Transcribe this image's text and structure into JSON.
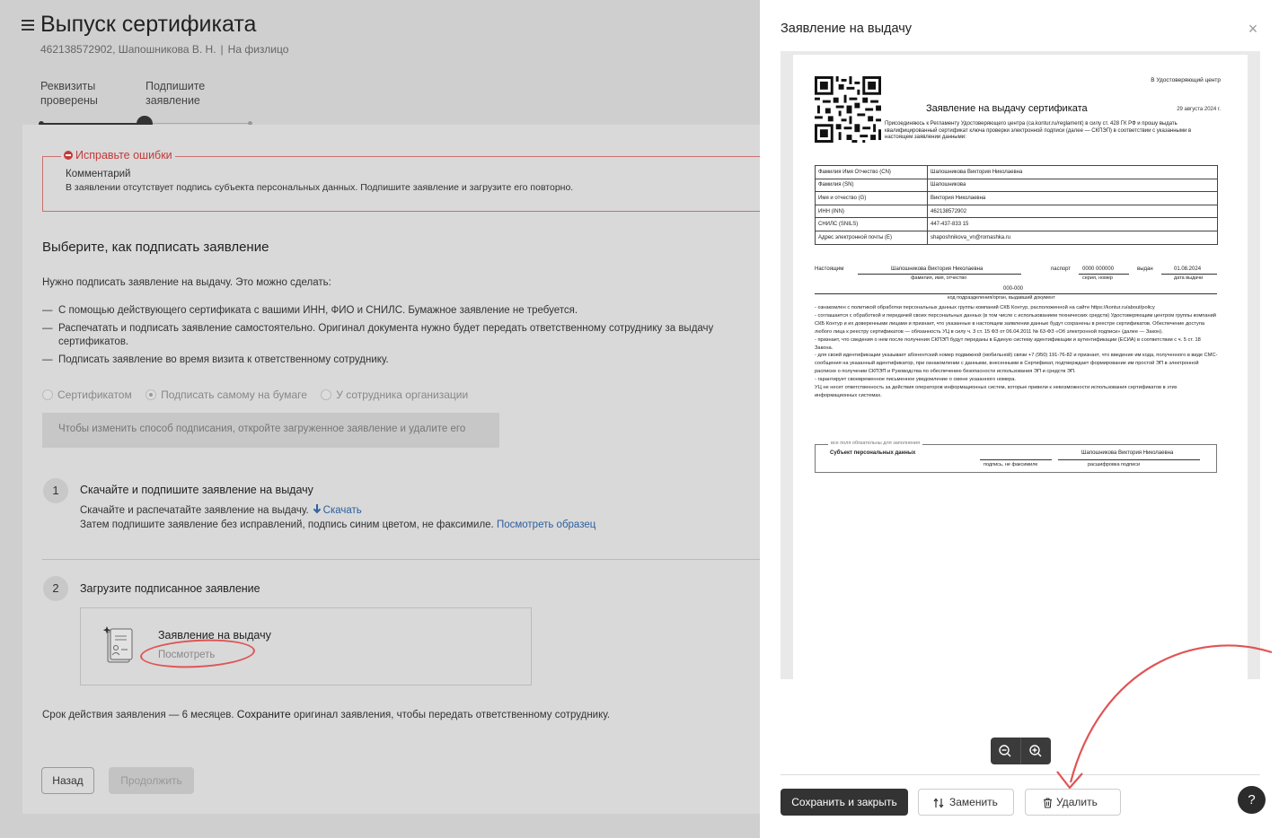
{
  "page": {
    "title": "Выпуск сертификата",
    "subtitle_id": "462138572902, Шапошникова В. Н.",
    "subtitle_sep": "|",
    "subtitle_type": "На физлицо"
  },
  "stepper": {
    "steps": [
      {
        "label": "Реквизиты проверены",
        "state": "done"
      },
      {
        "label": "Подпишите заявление",
        "state": "current"
      }
    ]
  },
  "error": {
    "title": "Исправьте ошибки",
    "comment_label": "Комментарий",
    "comment_text": "В заявлении отсутствует подпись субъекта персональных данных. Подпишите заявление и загрузите его повторно."
  },
  "sign": {
    "heading": "Выберите, как подписать заявление",
    "intro": "Нужно подписать заявление на выдачу. Это можно сделать:",
    "bullets": [
      "С помощью действующего сертификата с вашими ИНН, ФИО и СНИЛС. Бумажное заявление не требуется.",
      "Распечатать и подписать заявление самостоятельно. Оригинал документа нужно будет передать ответственному сотруднику за выдачу сертификатов.",
      "Подписать заявление во время визита к ответственному сотруднику."
    ],
    "options": [
      {
        "label": "Сертификатом",
        "checked": false
      },
      {
        "label": "Подписать самому на бумаге",
        "checked": true
      },
      {
        "label": "У сотрудника организации",
        "checked": false
      }
    ],
    "hint": "Чтобы изменить способ подписания, откройте загруженное заявление и удалите его"
  },
  "step1": {
    "num": "1",
    "title": "Скачайте и подпишите заявление на выдачу",
    "text1": "Скачайте и распечатайте заявление на выдачу.",
    "download": "Скачать",
    "text2": "Затем подпишите заявление без исправлений, подпись синим цветом, не факсимиле.",
    "sample": "Посмотреть образец"
  },
  "step2": {
    "num": "2",
    "title": "Загрузите подписанное заявление",
    "file_name": "Заявление на выдачу",
    "file_view": "Посмотреть"
  },
  "validity": {
    "text1": "Срок действия заявления — 6 месяцев.",
    "bold": "Сохраните",
    "text2": "оригинал заявления, чтобы передать ответственному сотруднику."
  },
  "buttons": {
    "back": "Назад",
    "next": "Продолжить"
  },
  "panel": {
    "title": "Заявление на выдачу",
    "close": "×",
    "save": "Сохранить и закрыть",
    "replace": "Заменить",
    "delete": "Удалить",
    "help": "?"
  },
  "doc": {
    "to": "В Удостоверяющий центр",
    "title": "Заявление на выдачу сертификата",
    "date": "29 августа 2024 г.",
    "intro": "Присоединяюсь к Регламенту Удостоверяющего центра (ca.kontur.ru/reglament) в силу ст. 428 ГК РФ и прошу выдать квалифицированный сертификат ключа проверки электронной подписи (далее — СКПЭП) в соответствии с указанными в настоящем заявлении данными:",
    "rows": [
      {
        "k": "Фамилия Имя Отчество (CN)",
        "v": "Шапошникова Виктория Николаевна"
      },
      {
        "k": "Фамилия (SN)",
        "v": "Шапошникова"
      },
      {
        "k": "Имя и отчество (G)",
        "v": "Виктория Николаевна"
      },
      {
        "k": "ИНН (INN)",
        "v": "462138572902"
      },
      {
        "k": "СНИЛС (SNILS)",
        "v": "447-437-833 15"
      },
      {
        "k": "Адрес электронной почты (E)",
        "v": "shaposhnikova_vn@romashka.ru"
      }
    ],
    "nast": "Настоящим",
    "fio": "Шапошникова Виктория Николаевна",
    "passport_label": "паспорт",
    "passport": "0000 000000",
    "issued": "выдан",
    "issue_date": "01.08.2024",
    "cap_fio": "фамилия, имя, отчество",
    "cap_series": "серия, номер",
    "cap_date": "дата выдачи",
    "dept_code": "000-000",
    "cap_dept": "код подразделения/орган, выдавший документ",
    "body": [
      "- ознакомлен с политикой обработки персональных данных группы компаний СКБ Контур, расположенной на сайте https://kontur.ru/about/policy",
      "- соглашается с обработкой и передачей своих персональных данных (в том числе с использованием технических средств) Удостоверяющим центром группы компаний СКБ Контур и их доверенными лицами и признает, что указанные в настоящем заявлении данные будут сохранены в реестре сертификатов. Обеспечение доступа любого лица к реестру сертификатов — обязанность УЦ в силу ч. 3 ст. 15 ФЗ от 06.04.2011 № 63-ФЗ «Об электронной подписи» (далее — Закон).",
      "- признает, что сведения о нем после получения СКПЭП будут переданы в Единую систему идентификации и аутентификации (ЕСИА) в соответствии с ч. 5 ст. 18 Закона.",
      "- для своей идентификации указывает абонентский номер подвижной (мобильной) связи +7 (950) 191-76-82 и признает, что введение им кода, полученного в виде СМС-сообщения на указанный идентификатор, при ознакомлении с данными, внесенными в Сертификат, подтверждает формирование им простой ЭП в электронной расписке о получении СКПЭП и Руководства по обеспечению безопасности использования ЭП и средств ЭП.",
      "- гарантирует своевременное письменное уведомление о смене указанного номера.",
      "УЦ не несет ответственность за действия операторов информационных систем, которые привели к невозможности использования сертификатов в этих информационных системах."
    ],
    "req_fields": "все поля обязательны для заполнения",
    "subject": "Субъект персональных данных",
    "sign_name": "Шапошникова Виктория Николаевна",
    "cap_sign": "подпись, не факсимиле",
    "cap_decode": "расшифровка подписи"
  }
}
